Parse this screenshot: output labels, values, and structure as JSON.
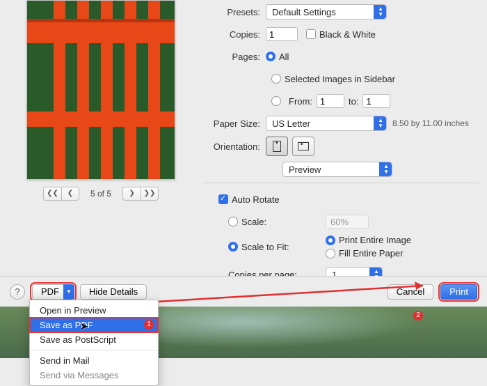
{
  "presets": {
    "label": "Presets:",
    "value": "Default Settings"
  },
  "copies": {
    "label": "Copies:",
    "value": "1",
    "bw": "Black & White"
  },
  "pages": {
    "label": "Pages:",
    "all": "All",
    "selected": "Selected Images in Sidebar",
    "from_label": "From:",
    "from": "1",
    "to_label": "to:",
    "to": "1"
  },
  "paper": {
    "label": "Paper Size:",
    "value": "US Letter",
    "dim": "8.50 by 11.00 inches"
  },
  "orientation": {
    "label": "Orientation:"
  },
  "section": {
    "value": "Preview"
  },
  "auto_rotate": "Auto Rotate",
  "scale": {
    "scale": "Scale:",
    "scale_val": "60%",
    "fit": "Scale to Fit:",
    "entire_image": "Print Entire Image",
    "fill_paper": "Fill Entire Paper"
  },
  "cpp": {
    "label": "Copies per page:",
    "value": "1"
  },
  "pager": {
    "label": "5 of 5",
    "first": "❮❮",
    "prev": "❮",
    "next": "❯",
    "last": "❯❯"
  },
  "bottom": {
    "help": "?",
    "pdf": "PDF",
    "hide": "Hide Details",
    "cancel": "Cancel",
    "print": "Print"
  },
  "menu": {
    "open": "Open in Preview",
    "save_pdf": "Save as PDF",
    "save_ps": "Save as PostScript",
    "mail": "Send in Mail",
    "msg": "Send via Messages"
  },
  "badges": {
    "one": "1",
    "two": "2"
  }
}
